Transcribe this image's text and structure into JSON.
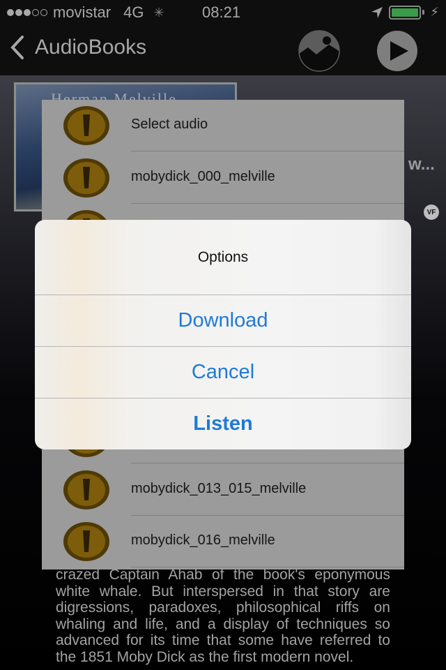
{
  "status_bar": {
    "signal_strength": "3 of 5",
    "carrier": "movistar",
    "network": "4G",
    "activity": "loading",
    "time": "08:21",
    "battery_color": "#3a9b48",
    "battery_level_percent": 100,
    "charging": true
  },
  "nav": {
    "back_label": "AudioBooks",
    "icons": [
      "image-icon",
      "play-icon"
    ]
  },
  "book": {
    "cover_text": "Herman Melville",
    "title_truncated": "w...",
    "publisher_logo": "VF",
    "description": "crazed Captain Ahab of the book's eponymous white whale. But interspersed in that story are digressions, paradoxes, philosophical riffs on whaling and life, and a display of techniques so advanced for its time that some have referred to the 1851 Moby Dick as the first modern novel."
  },
  "audio_list": {
    "items": [
      {
        "label": "Select audio"
      },
      {
        "label": "mobydick_000_melville"
      },
      {
        "label": ""
      },
      {
        "label": ""
      },
      {
        "label": ""
      },
      {
        "label": ""
      },
      {
        "label": ""
      },
      {
        "label": "mobydick_013_015_melville"
      },
      {
        "label": "mobydick_016_melville"
      }
    ]
  },
  "alert": {
    "title": "Options",
    "buttons": [
      {
        "label": "Download"
      },
      {
        "label": "Cancel"
      },
      {
        "label": "Listen"
      }
    ],
    "button_color": "#1f7ad6"
  }
}
